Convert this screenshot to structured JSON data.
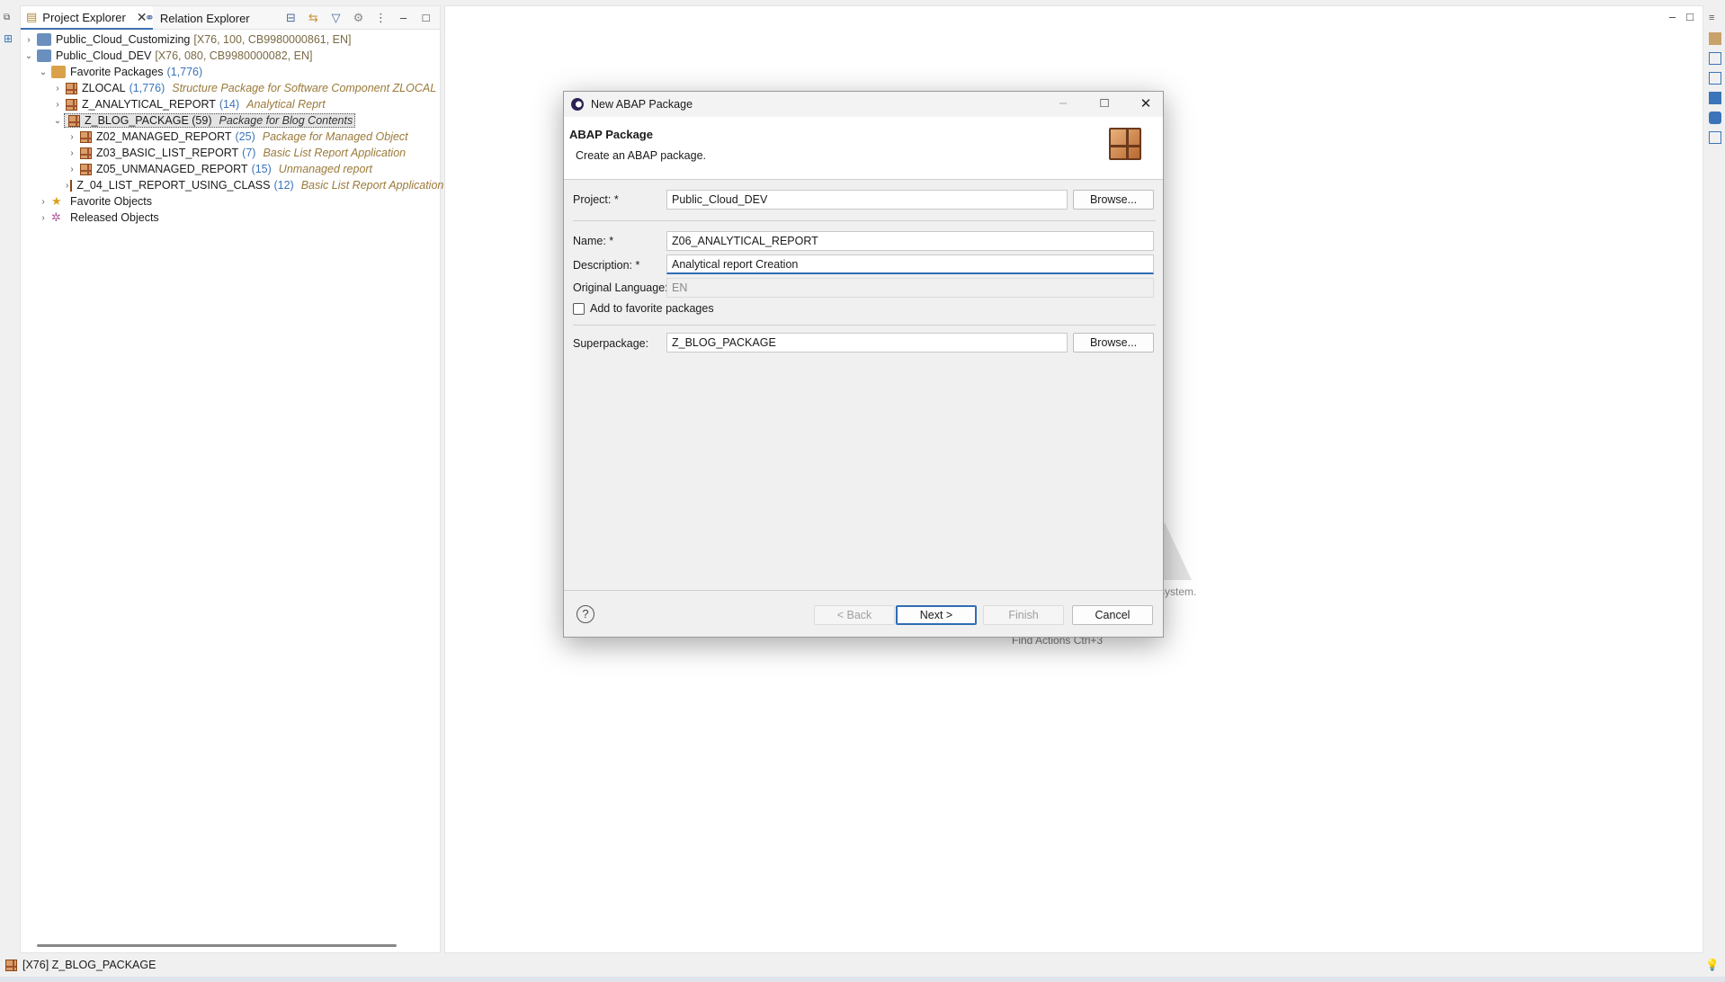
{
  "explorer": {
    "tabs": [
      {
        "label": "Project Explorer"
      },
      {
        "label": "Relation Explorer"
      }
    ],
    "tree": [
      {
        "name": "Public_Cloud_Customizing",
        "meta": "[X76, 100, CB9980000861, EN]"
      },
      {
        "name": "Public_Cloud_DEV",
        "meta": "[X76, 080, CB9980000082, EN]"
      },
      {
        "name": "Favorite Packages",
        "count": "(1,776)"
      },
      {
        "name": "ZLOCAL",
        "count": "(1,776)",
        "desc": "Structure Package for Software Component ZLOCAL"
      },
      {
        "name": "Z_ANALYTICAL_REPORT",
        "count": "(14)",
        "desc": "Analytical Reprt"
      },
      {
        "name": "Z_BLOG_PACKAGE (59)",
        "desc": "Package for Blog Contents"
      },
      {
        "name": "Z02_MANAGED_REPORT",
        "count": "(25)",
        "desc": "Package for Managed Object"
      },
      {
        "name": "Z03_BASIC_LIST_REPORT",
        "count": "(7)",
        "desc": "Basic List Report Application"
      },
      {
        "name": "Z05_UNMANAGED_REPORT",
        "count": "(15)",
        "desc": "Unmanaged report"
      },
      {
        "name": "Z_04_LIST_REPORT_USING_CLASS",
        "count": "(12)",
        "desc": "Basic List Report Application usir"
      },
      {
        "name": "Favorite Objects"
      },
      {
        "name": "Released Objects"
      }
    ]
  },
  "editor": {
    "hint_system": "system.",
    "hint_find": "Find Actions   Ctrl+3"
  },
  "statusbar": {
    "text": "[X76] Z_BLOG_PACKAGE"
  },
  "dialog": {
    "title": "New ABAP Package",
    "header_title": "ABAP Package",
    "header_sub": "Create an ABAP package.",
    "project_label": "Project: *",
    "project_value": "Public_Cloud_DEV",
    "browse_label": "Browse...",
    "name_label": "Name: *",
    "name_value": "Z06_ANALYTICAL_REPORT",
    "description_label": "Description: *",
    "description_value": "Analytical report Creation",
    "language_label": "Original Language:",
    "language_value": "EN",
    "favorite_label": "Add to favorite packages",
    "superpackage_label": "Superpackage:",
    "superpackage_value": "Z_BLOG_PACKAGE",
    "back_label": "< Back",
    "next_label": "Next >",
    "finish_label": "Finish",
    "cancel_label": "Cancel",
    "help_glyph": "?"
  },
  "colors": {
    "accent": "#2f6db3",
    "package_icon": "#d99e6a",
    "description_text": "#9b7a3a",
    "count_text": "#3b74b8"
  },
  "icons": [
    "package-icon",
    "project-icon",
    "star-icon",
    "gear-icon",
    "help-icon",
    "close-icon",
    "filter-icon",
    "collapse-all-icon",
    "link-icon"
  ]
}
